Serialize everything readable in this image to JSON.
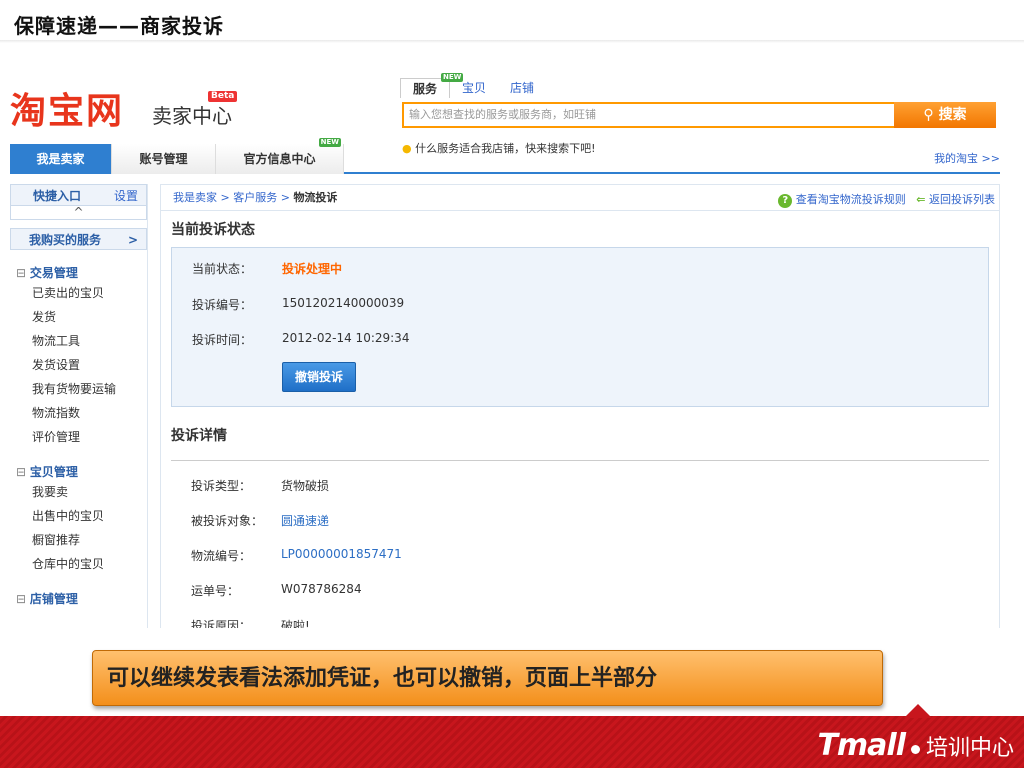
{
  "slide": {
    "title": "保障速递——商家投诉",
    "callout": "可以继续发表看法添加凭证，也可以撤销，页面上半部分",
    "footer_brand": "Tmall",
    "footer_sub": "培训中心"
  },
  "header": {
    "logo": "淘宝网",
    "logo_sub": "卖家中心",
    "beta": "Beta",
    "search_tabs": [
      {
        "label": "服务",
        "active": true,
        "new": true
      },
      {
        "label": "宝贝"
      },
      {
        "label": "店铺"
      }
    ],
    "search_placeholder": "输入您想查找的服务或服务商，如旺铺",
    "search_button": "搜索",
    "tip": "什么服务适合我店铺，快来搜索下吧!",
    "nav": [
      {
        "label": "我是卖家",
        "active": true
      },
      {
        "label": "账号管理"
      },
      {
        "label": "官方信息中心",
        "new": true
      }
    ],
    "my_taobao": "我的淘宝 >>",
    "new_tag": "NEW"
  },
  "sidebar": {
    "quick_entry": "快捷入口",
    "settings": "设置",
    "bought_services": "我购买的服务",
    "bought_arrow": ">",
    "sections": [
      {
        "title": "交易管理",
        "items": [
          "已卖出的宝贝",
          "发货",
          "物流工具",
          "发货设置",
          "我有货物要运输",
          "物流指数",
          "评价管理"
        ]
      },
      {
        "title": "宝贝管理",
        "items": [
          "我要卖",
          "出售中的宝贝",
          "橱窗推荐",
          "仓库中的宝贝"
        ]
      },
      {
        "title": "店铺管理",
        "items": []
      }
    ]
  },
  "main": {
    "breadcrumb": [
      "我是卖家",
      "客户服务",
      "物流投诉"
    ],
    "rules_link": "查看淘宝物流投诉规则",
    "back_link": "返回投诉列表",
    "status_title": "当前投诉状态",
    "status": {
      "state_label": "当前状态：",
      "state_value": "投诉处理中",
      "id_label": "投诉编号：",
      "id_value": "1501202140000039",
      "time_label": "投诉时间：",
      "time_value": "2012-02-14 10:29:34",
      "cancel_button": "撤销投诉"
    },
    "detail_title": "投诉详情",
    "details": [
      {
        "label": "投诉类型：",
        "value": "货物破损",
        "link": false
      },
      {
        "label": "被投诉对象：",
        "value": "圆通速递",
        "link": true
      },
      {
        "label": "物流编号：",
        "value": "LP00000001857471",
        "link": true
      },
      {
        "label": "运单号：",
        "value": "W078786284",
        "link": false
      },
      {
        "label": "投诉原因：",
        "value": "破啦!",
        "link": false
      }
    ]
  },
  "colors": {
    "accent": "#2f7fd0",
    "orange": "#f60",
    "brand_red": "#c8161d"
  }
}
